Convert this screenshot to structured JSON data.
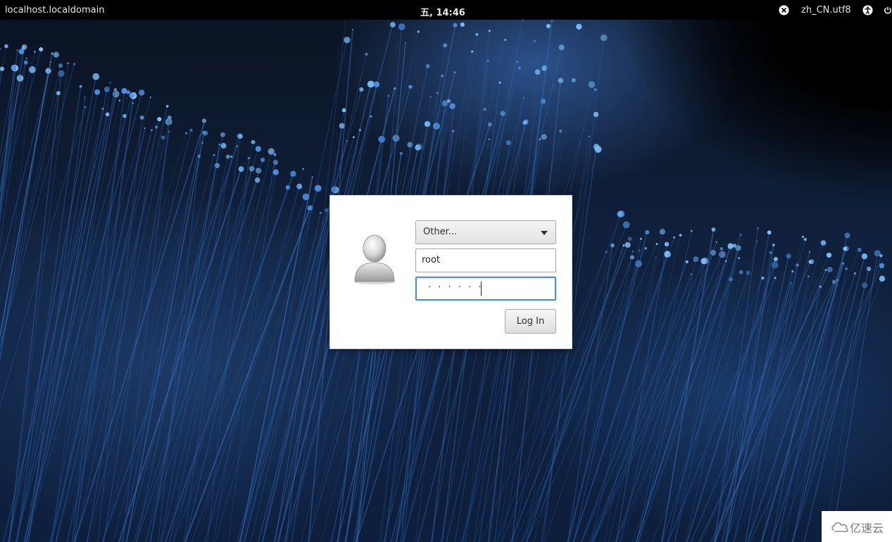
{
  "top_bar": {
    "hostname": "localhost.localdomain",
    "clock": "五, 14:46",
    "status": {
      "input_method_icon": "ibus-icon",
      "locale": "zh_CN.utf8",
      "accessibility_icon": "accessibility-icon",
      "power_icon": "power-icon"
    }
  },
  "login": {
    "avatar_icon": "user-avatar-icon",
    "user_select": {
      "selected": "Other..."
    },
    "username": {
      "value": "root"
    },
    "password": {
      "masked_value": "· · · · · ·"
    },
    "login_button": "Log In"
  },
  "watermark": {
    "text": "亿速云"
  },
  "colors": {
    "top_bar_bg": "#000000",
    "focus_border": "#4a90d9",
    "wallpaper_blue": "#1e4a8a"
  }
}
